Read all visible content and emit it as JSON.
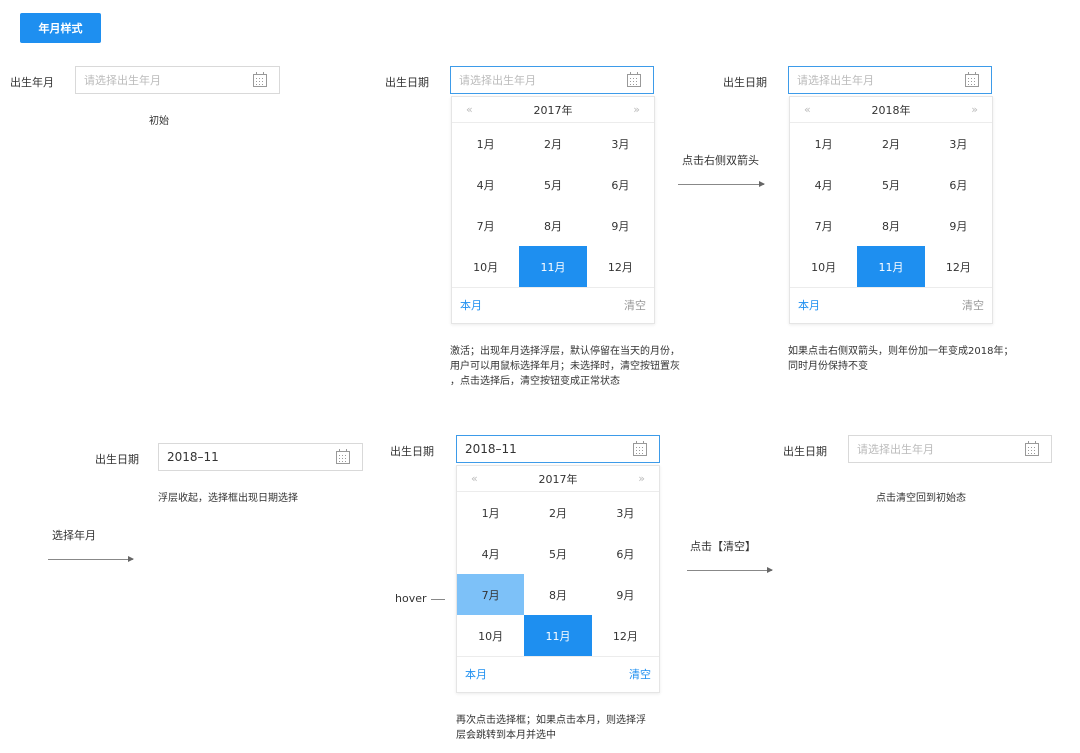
{
  "header": {
    "tag_button": "年月样式"
  },
  "state1": {
    "label": "出生年月",
    "placeholder": "请选择出生年月",
    "caption": "初始"
  },
  "state2": {
    "label": "出生日期",
    "placeholder": "请选择出生年月",
    "year": "2017年",
    "prev": "«",
    "next": "»",
    "months": [
      "1月",
      "2月",
      "3月",
      "4月",
      "5月",
      "6月",
      "7月",
      "8月",
      "9月",
      "10月",
      "11月",
      "12月"
    ],
    "selected_index": 10,
    "footer_now": "本月",
    "footer_clear": "清空",
    "note": [
      "激活；出现年月选择浮层，默认停留在当天的月份，",
      "用户可以用鼠标选择年月；未选择时，清空按钮置灰",
      "，点击选择后，清空按钮变成正常状态"
    ]
  },
  "arrow1": {
    "label": "点击右侧双箭头"
  },
  "state3": {
    "label": "出生日期",
    "placeholder": "请选择出生年月",
    "year": "2018年",
    "prev": "«",
    "next": "»",
    "months": [
      "1月",
      "2月",
      "3月",
      "4月",
      "5月",
      "6月",
      "7月",
      "8月",
      "9月",
      "10月",
      "11月",
      "12月"
    ],
    "selected_index": 10,
    "footer_now": "本月",
    "footer_clear": "清空",
    "note": [
      "如果点击右侧双箭头，则年份加一年变成2018年；",
      "同时月份保持不变"
    ]
  },
  "state4": {
    "label": "出生日期",
    "value": "2018–11",
    "caption": "浮层收起，选择框出现日期选择"
  },
  "arrow2": {
    "label": "选择年月"
  },
  "state5": {
    "label": "出生日期",
    "value": "2018–11",
    "year": "2017年",
    "prev": "«",
    "next": "»",
    "months": [
      "1月",
      "2月",
      "3月",
      "4月",
      "5月",
      "6月",
      "7月",
      "8月",
      "9月",
      "10月",
      "11月",
      "12月"
    ],
    "selected_index": 10,
    "hover_index": 6,
    "hover_label": "hover",
    "footer_now": "本月",
    "footer_clear": "清空",
    "note": [
      "再次点击选择框；如果点击本月，则选择浮",
      "层会跳转到本月并选中"
    ]
  },
  "arrow3": {
    "label": "点击【清空】"
  },
  "state6": {
    "label": "出生日期",
    "placeholder": "请选择出生年月",
    "caption": "点击清空回到初始态"
  },
  "colors": {
    "primary": "#1e8ff0",
    "hover": "#7dc1f8",
    "border": "#d9d9d9",
    "active_border": "#3d9be9"
  },
  "icons": {
    "calendar": "calendar-icon"
  }
}
